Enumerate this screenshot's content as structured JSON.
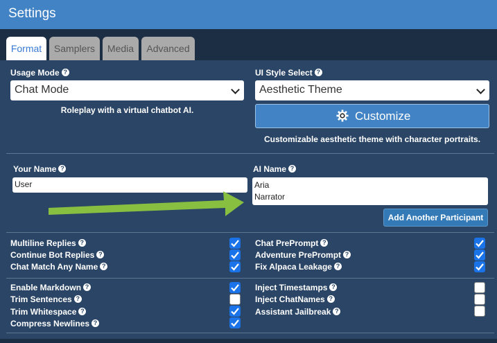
{
  "window": {
    "title": "Settings"
  },
  "tabs": [
    {
      "label": "Format",
      "active": true
    },
    {
      "label": "Samplers",
      "active": false
    },
    {
      "label": "Media",
      "active": false
    },
    {
      "label": "Advanced",
      "active": false
    }
  ],
  "usage_mode": {
    "label": "Usage Mode",
    "help": "?",
    "value": "Chat Mode",
    "description": "Roleplay with a virtual chatbot AI."
  },
  "ui_style": {
    "label": "UI Style Select",
    "help": "?",
    "value": "Aesthetic Theme",
    "customize_label": "Customize",
    "customize_icon": "gear-icon",
    "description": "Customizable aesthetic theme with character portraits."
  },
  "names": {
    "your_name_label": "Your Name",
    "your_name_value": "User",
    "ai_name_label": "AI Name",
    "ai_name_lines": [
      "Aria",
      "Narrator"
    ],
    "add_participant_label": "Add Another Participant",
    "help": "?"
  },
  "options_left_top": [
    {
      "label": "Multiline Replies",
      "checked": true
    },
    {
      "label": "Continue Bot Replies",
      "checked": true
    },
    {
      "label": "Chat Match Any Name",
      "checked": true
    }
  ],
  "options_right_top": [
    {
      "label": "Chat PrePrompt",
      "checked": true
    },
    {
      "label": "Adventure PrePrompt",
      "checked": true
    },
    {
      "label": "Fix Alpaca Leakage",
      "checked": true
    }
  ],
  "options_left_bottom": [
    {
      "label": "Enable Markdown",
      "checked": true
    },
    {
      "label": "Trim Sentences",
      "checked": false
    },
    {
      "label": "Trim Whitespace",
      "checked": true
    },
    {
      "label": "Compress Newlines",
      "checked": true
    }
  ],
  "options_right_bottom": [
    {
      "label": "Inject Timestamps",
      "checked": false
    },
    {
      "label": "Inject ChatNames",
      "checked": false
    },
    {
      "label": "Assistant Jailbreak",
      "checked": false
    }
  ],
  "colors": {
    "titlebar": "#4183c4",
    "panel": "#2a4565",
    "checkbox_on": "#1a73e8",
    "annotation_arrow": "#8dc63f"
  }
}
